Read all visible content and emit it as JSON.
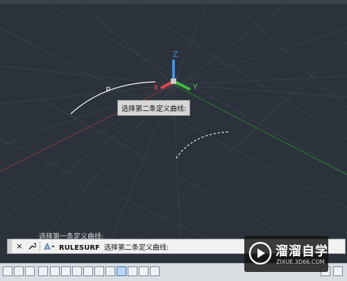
{
  "viewport": {
    "axis_z_label": "Z",
    "axis_x_label": "X",
    "axis_y_label": "Y",
    "colors": {
      "background": "#2c323b",
      "grid": "#3a414b",
      "x_axis": "#e04848",
      "y_axis": "#3fbf3f",
      "z_axis": "#4d8fd6",
      "curve": "#ffffff"
    }
  },
  "tooltip": {
    "text": "选择第二条定义曲线:"
  },
  "command_history": {
    "line": "选择第一条定义曲线:"
  },
  "command_bar": {
    "close_icon": "close-icon",
    "settings_icon": "wrench-icon",
    "recent_icon": "recent-commands-icon",
    "command_name": "RULESURF",
    "prompt": "选择第二条定义曲线:"
  },
  "status_bar": {
    "buttons": [
      "grid-display",
      "snap-mode",
      "infer-constraints",
      "ortho-mode",
      "polar-tracking",
      "object-snap",
      "3d-object-snap",
      "object-snap-tracking",
      "dynamic-ucs",
      "dynamic-input",
      "show-lineweight",
      "transparency",
      "quick-properties",
      "selection-cycling"
    ]
  },
  "watermark": {
    "title": "溜溜自学",
    "url": "ZIXUE.3D66.COM"
  }
}
